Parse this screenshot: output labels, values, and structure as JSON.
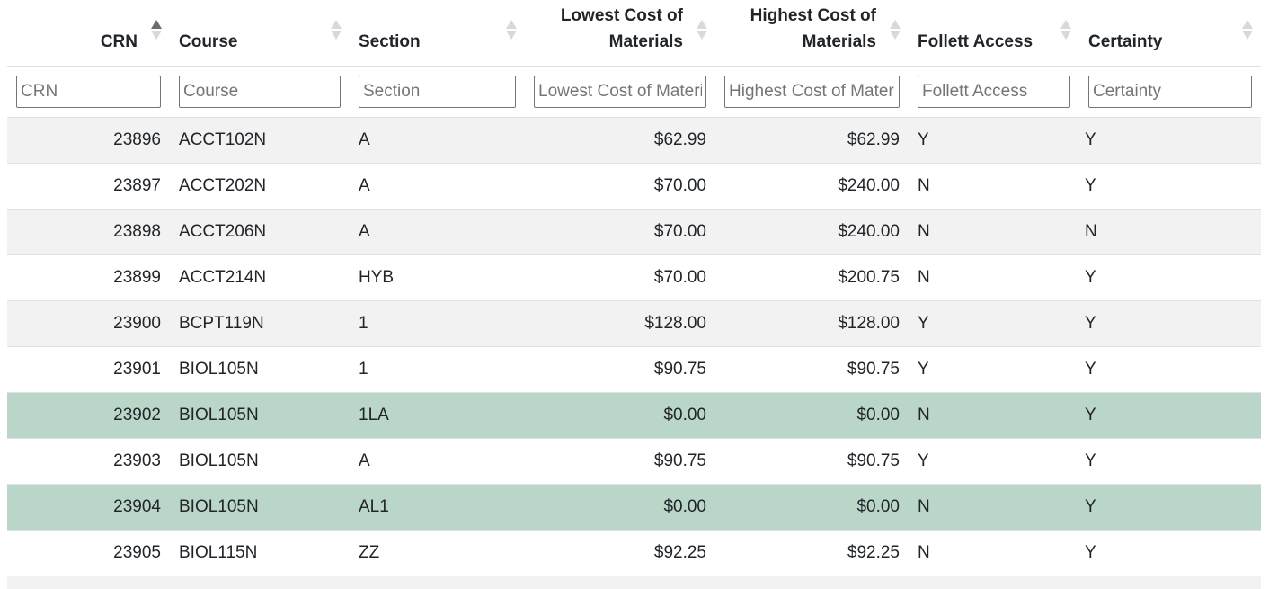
{
  "columns": [
    {
      "label_line1": "",
      "label_line2": "CRN",
      "placeholder": "CRN",
      "sorted": "asc"
    },
    {
      "label_line1": "",
      "label_line2": "Course",
      "placeholder": "Course",
      "sorted": "none"
    },
    {
      "label_line1": "",
      "label_line2": "Section",
      "placeholder": "Section",
      "sorted": "none"
    },
    {
      "label_line1": "Lowest Cost of",
      "label_line2": "Materials",
      "placeholder": "Lowest Cost of Materials",
      "sorted": "none"
    },
    {
      "label_line1": "Highest Cost of",
      "label_line2": "Materials",
      "placeholder": "Highest Cost of Materials",
      "sorted": "none"
    },
    {
      "label_line1": "",
      "label_line2": "Follett Access",
      "placeholder": "Follett Access",
      "sorted": "none"
    },
    {
      "label_line1": "",
      "label_line2": "Certainty",
      "placeholder": "Certainty",
      "sorted": "none"
    }
  ],
  "rows": [
    {
      "crn": "23896",
      "course": "ACCT102N",
      "section": "A",
      "low": "$62.99",
      "high": "$62.99",
      "follett": "Y",
      "certainty": "Y",
      "highlight": false
    },
    {
      "crn": "23897",
      "course": "ACCT202N",
      "section": "A",
      "low": "$70.00",
      "high": "$240.00",
      "follett": "N",
      "certainty": "Y",
      "highlight": false
    },
    {
      "crn": "23898",
      "course": "ACCT206N",
      "section": "A",
      "low": "$70.00",
      "high": "$240.00",
      "follett": "N",
      "certainty": "N",
      "highlight": false
    },
    {
      "crn": "23899",
      "course": "ACCT214N",
      "section": "HYB",
      "low": "$70.00",
      "high": "$200.75",
      "follett": "N",
      "certainty": "Y",
      "highlight": false
    },
    {
      "crn": "23900",
      "course": "BCPT119N",
      "section": "1",
      "low": "$128.00",
      "high": "$128.00",
      "follett": "Y",
      "certainty": "Y",
      "highlight": false
    },
    {
      "crn": "23901",
      "course": "BIOL105N",
      "section": "1",
      "low": "$90.75",
      "high": "$90.75",
      "follett": "Y",
      "certainty": "Y",
      "highlight": false
    },
    {
      "crn": "23902",
      "course": "BIOL105N",
      "section": "1LA",
      "low": "$0.00",
      "high": "$0.00",
      "follett": "N",
      "certainty": "Y",
      "highlight": true
    },
    {
      "crn": "23903",
      "course": "BIOL105N",
      "section": "A",
      "low": "$90.75",
      "high": "$90.75",
      "follett": "Y",
      "certainty": "Y",
      "highlight": false
    },
    {
      "crn": "23904",
      "course": "BIOL105N",
      "section": "AL1",
      "low": "$0.00",
      "high": "$0.00",
      "follett": "N",
      "certainty": "Y",
      "highlight": true
    },
    {
      "crn": "23905",
      "course": "BIOL115N",
      "section": "ZZ",
      "low": "$92.25",
      "high": "$92.25",
      "follett": "N",
      "certainty": "Y",
      "highlight": false
    }
  ],
  "colors": {
    "stripe": "#f2f2f2",
    "highlight": "#bad6c9",
    "sort_active": "#6c6c6c",
    "sort_inactive": "#d9d9d9"
  }
}
